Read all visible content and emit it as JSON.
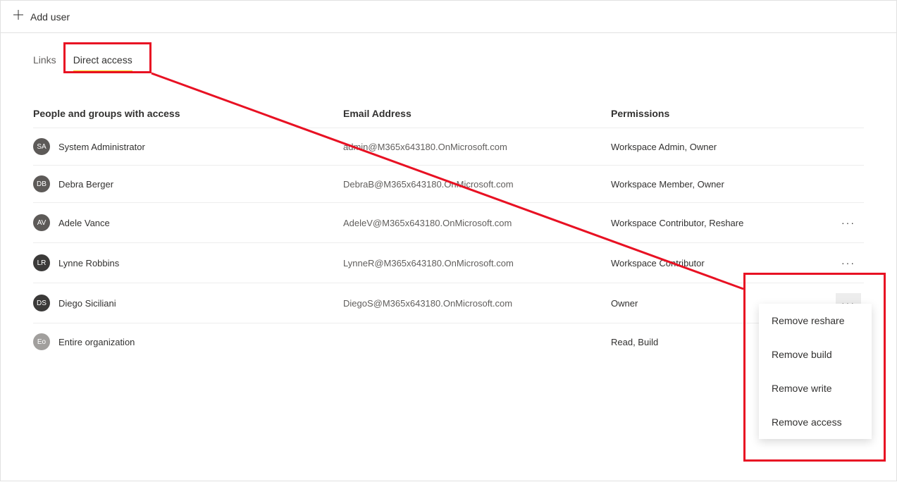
{
  "topbar": {
    "add_user_label": "Add user"
  },
  "tabs": {
    "links_label": "Links",
    "direct_access_label": "Direct access"
  },
  "columns": {
    "people": "People and groups with access",
    "email": "Email Address",
    "permissions": "Permissions"
  },
  "rows": [
    {
      "initials": "SA",
      "color": "#5d5a58",
      "name": "System Administrator",
      "email": "admin@M365x643180.OnMicrosoft.com",
      "permissions": "Workspace Admin, Owner",
      "has_more": false,
      "more_highlight": false
    },
    {
      "initials": "DB",
      "color": "#5d5a58",
      "name": "Debra Berger",
      "email": "DebraB@M365x643180.OnMicrosoft.com",
      "permissions": "Workspace Member, Owner",
      "has_more": false,
      "more_highlight": false
    },
    {
      "initials": "AV",
      "color": "#5d5a58",
      "name": "Adele Vance",
      "email": "AdeleV@M365x643180.OnMicrosoft.com",
      "permissions": "Workspace Contributor, Reshare",
      "has_more": true,
      "more_highlight": false
    },
    {
      "initials": "LR",
      "color": "#3b3a39",
      "name": "Lynne Robbins",
      "email": "LynneR@M365x643180.OnMicrosoft.com",
      "permissions": "Workspace Contributor",
      "has_more": true,
      "more_highlight": false
    },
    {
      "initials": "DS",
      "color": "#3b3a39",
      "name": "Diego Siciliani",
      "email": "DiegoS@M365x643180.OnMicrosoft.com",
      "permissions": "Owner",
      "has_more": true,
      "more_highlight": true
    },
    {
      "initials": "Eo",
      "color": "#a19f9d",
      "name": "Entire organization",
      "email": "",
      "permissions": "Read, Build",
      "has_more": false,
      "more_highlight": false
    }
  ],
  "more_glyph": "···",
  "context_menu": {
    "items": [
      "Remove reshare",
      "Remove build",
      "Remove write",
      "Remove access"
    ]
  }
}
